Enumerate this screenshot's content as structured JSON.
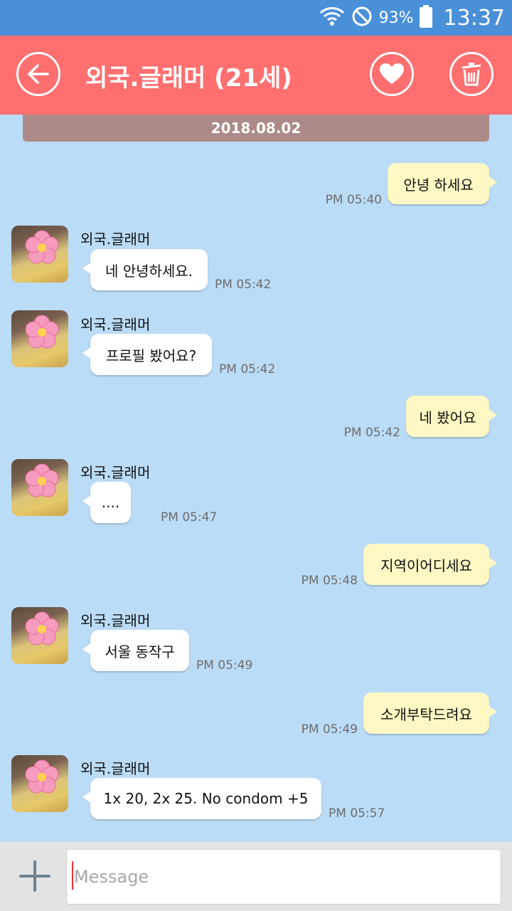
{
  "status_bar": {
    "battery_text": "93%",
    "time": "13:37"
  },
  "header": {
    "title": "외국.글래머 (21세)",
    "icons": [
      "back-arrow-icon",
      "heart-icon",
      "trash-icon"
    ]
  },
  "date_divider": "2018.08.02",
  "messages": [
    {
      "dir": "out",
      "text": "안녕 하세요",
      "time": "PM 05:40"
    },
    {
      "dir": "in",
      "sender": "외국.글래머",
      "text": "네 안녕하세요.",
      "time": "PM 05:42"
    },
    {
      "dir": "in",
      "sender": "외국.글래머",
      "text": "프로필 봤어요?",
      "time": "PM 05:42"
    },
    {
      "dir": "out",
      "text": "네 봤어요",
      "time": "PM 05:42"
    },
    {
      "dir": "in",
      "sender": "외국.글래머",
      "text": "....",
      "time": "PM 05:47"
    },
    {
      "dir": "out",
      "text": "지역이어디세요",
      "time": "PM 05:48"
    },
    {
      "dir": "in",
      "sender": "외국.글래머",
      "text": "서울 동작구",
      "time": "PM 05:49"
    },
    {
      "dir": "out",
      "text": "소개부탁드려요",
      "time": "PM 05:49"
    },
    {
      "dir": "in",
      "sender": "외국.글래머",
      "text": "1x 20, 2x 25. No condom +5",
      "time": "PM 05:57"
    }
  ],
  "composer": {
    "placeholder": "Message",
    "add_icon": "plus-icon"
  },
  "colors": {
    "header": "#ff6f6f",
    "status_bar": "#4a90d9",
    "background": "#bbdcf6",
    "outgoing_bubble": "#fff8c4",
    "incoming_bubble": "#ffffff",
    "date_bar": "#ad8a8a"
  }
}
